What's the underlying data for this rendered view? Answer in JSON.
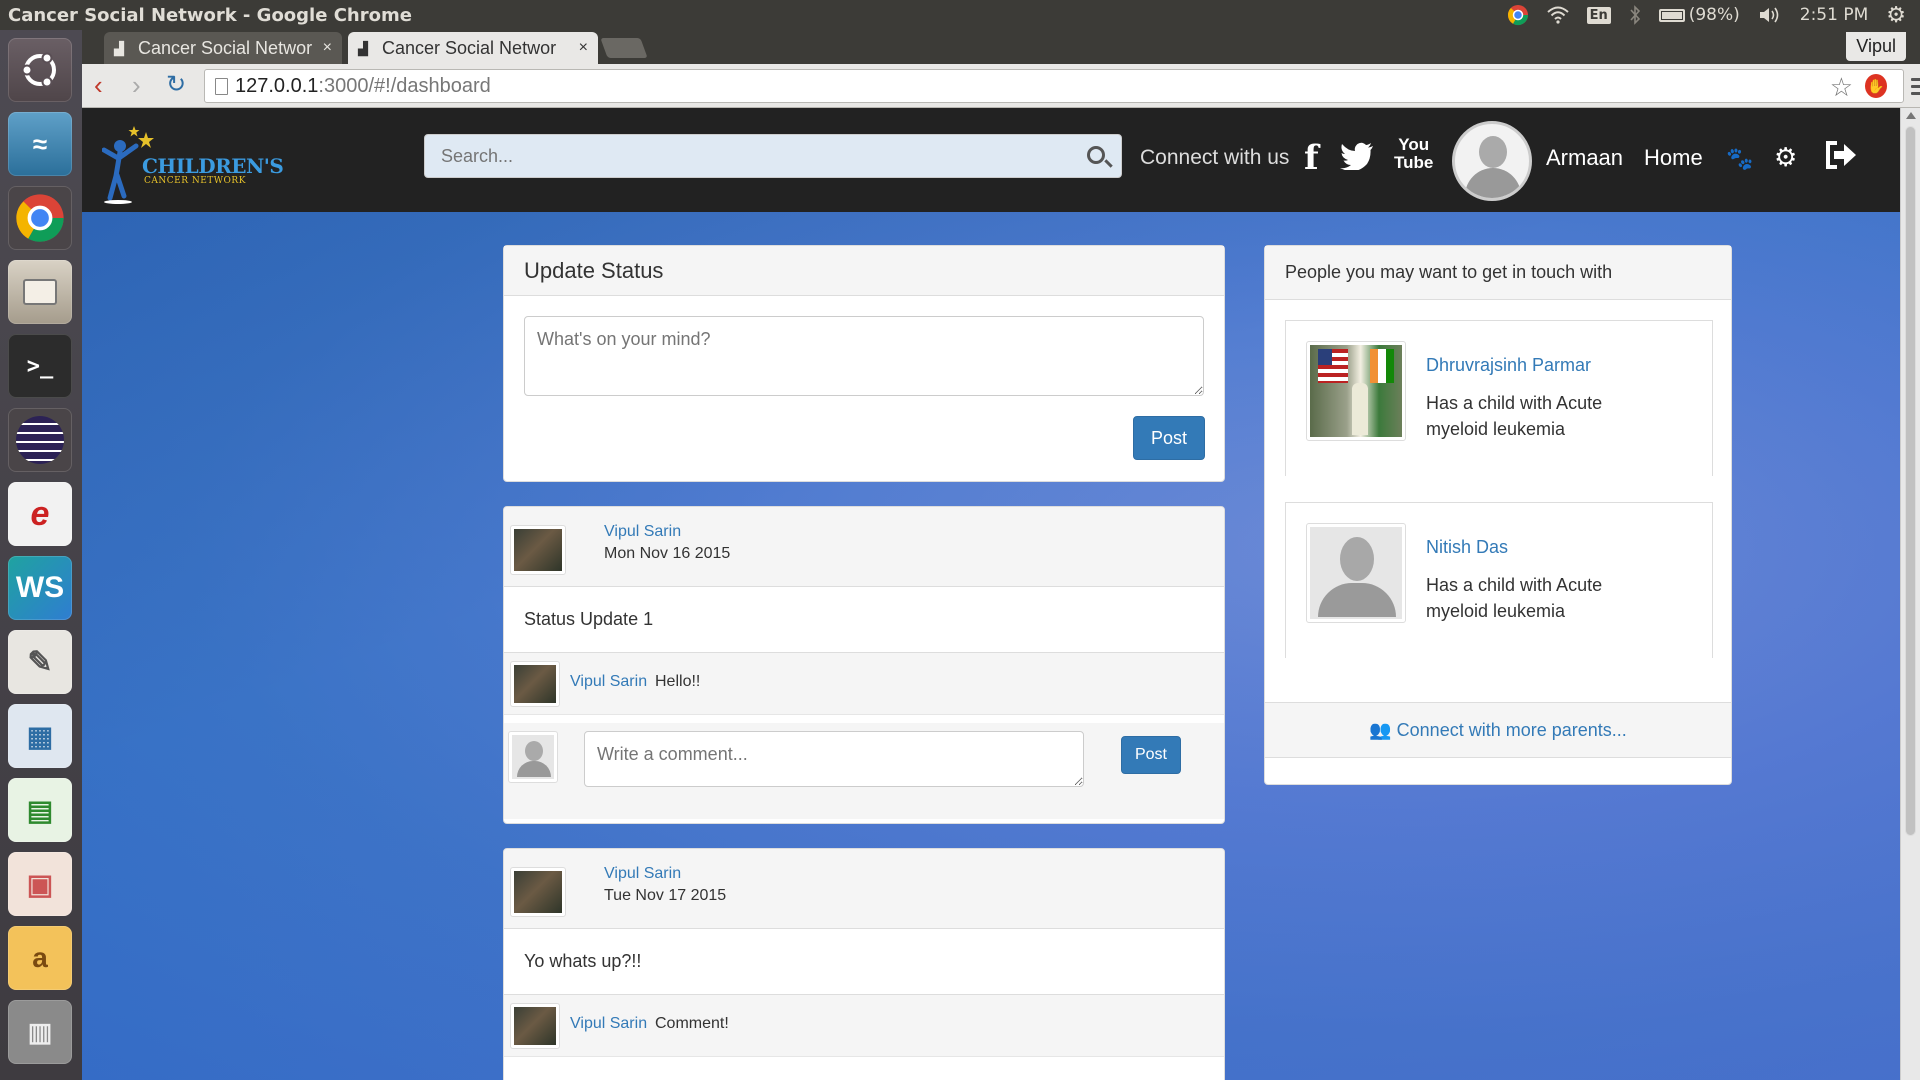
{
  "os": {
    "window_title": "Cancer Social Network - Google Chrome",
    "language": "En",
    "battery": "(98%)",
    "clock": "2:51 PM"
  },
  "browser": {
    "tabs": [
      {
        "label": "Cancer Social Networ"
      },
      {
        "label": "Cancer Social Networ"
      }
    ],
    "user": "Vipul",
    "url_host": "127.0.0.1",
    "url_path": ":3000/#!/dashboard"
  },
  "navbar": {
    "logo_text": "CHILDREN'S",
    "logo_sub": "CANCER NETWORK",
    "search_placeholder": "Search...",
    "connect_label": "Connect with us",
    "youtube_top": "You",
    "youtube_bottom": "Tube",
    "username": "Armaan",
    "home_label": "Home"
  },
  "status_panel": {
    "heading": "Update Status",
    "placeholder": "What's on your mind?",
    "post_label": "Post"
  },
  "posts": [
    {
      "author": "Vipul Sarin",
      "date": "Mon Nov 16 2015",
      "body": "Status Update 1",
      "comments": [
        {
          "author": "Vipul Sarin",
          "text": "Hello!!"
        }
      ],
      "comment_placeholder": "Write a comment...",
      "comment_post_label": "Post"
    },
    {
      "author": "Vipul Sarin",
      "date": "Tue Nov 17 2015",
      "body": "Yo whats up?!!",
      "comments": [
        {
          "author": "Vipul Sarin",
          "text": "Comment!"
        }
      ]
    }
  ],
  "people_panel": {
    "heading": "People you may want to get in touch with",
    "people": [
      {
        "name": "Dhruvrajsinh Parmar",
        "desc_1": "Has a child with Acute",
        "desc_2": "myeloid leukemia"
      },
      {
        "name": "Nitish Das",
        "desc_1": "Has a child with Acute",
        "desc_2": "myeloid leukemia"
      }
    ],
    "more_label": "Connect with more parents..."
  },
  "colors": {
    "navbar": "#222222",
    "link": "#337ab7",
    "primary_button": "#337ab7",
    "page_background": "#4f7bd0"
  }
}
